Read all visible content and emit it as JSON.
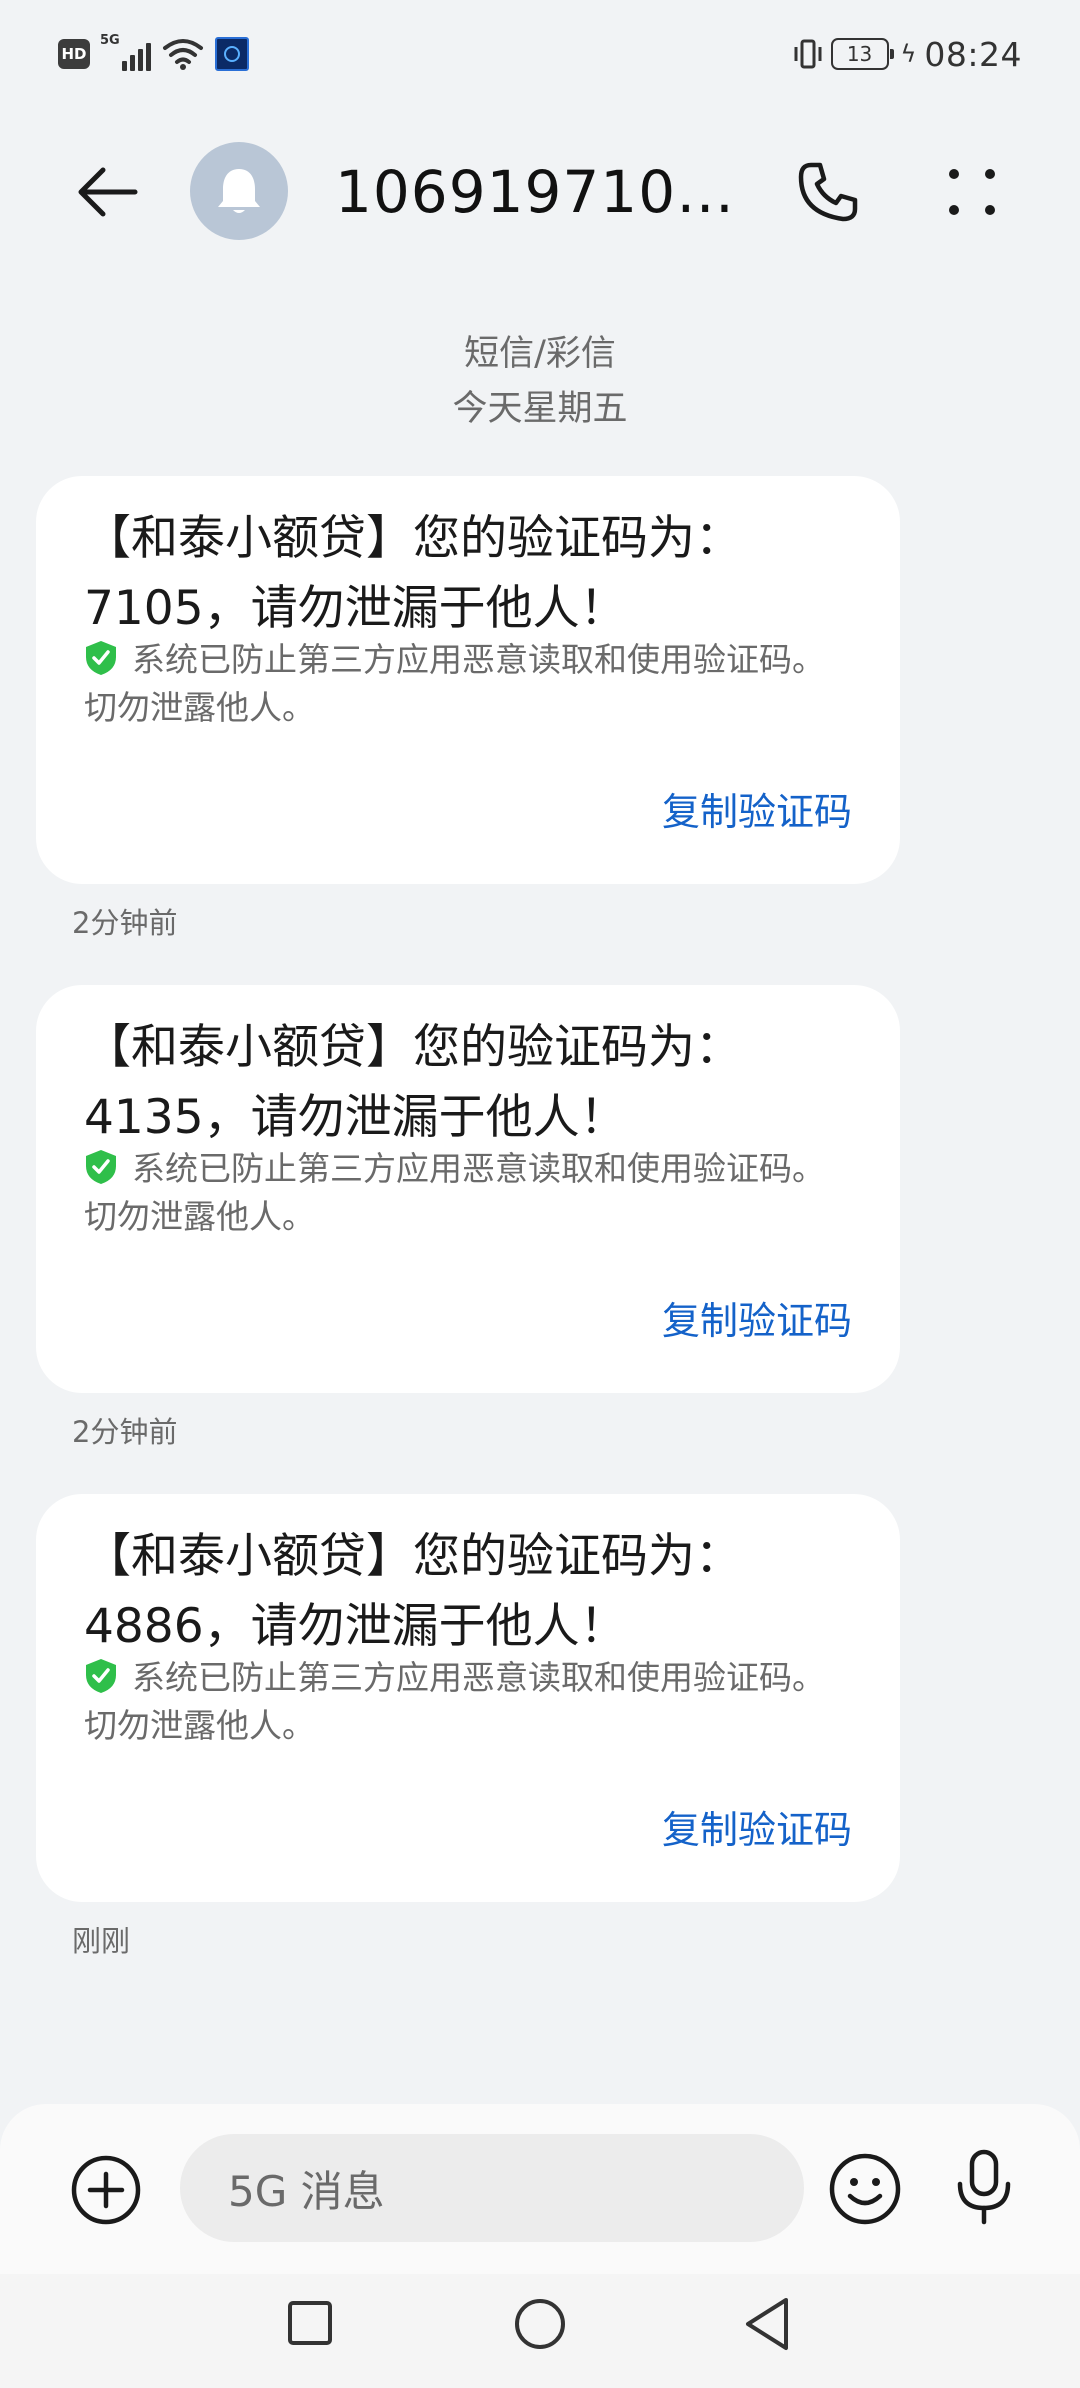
{
  "status_bar": {
    "hd_badge": "HD",
    "network": "5G",
    "battery_level": "13",
    "time": "08:24"
  },
  "header": {
    "contact_name": "1069197100..."
  },
  "conversation": {
    "message_type": "短信/彩信",
    "date": "今天星期五"
  },
  "messages": [
    {
      "line1": "【和泰小额贷】您的验证码为：",
      "line2": "7105，请勿泄漏于他人！",
      "security_note": "系统已防止第三方应用恶意读取和使用验证码。",
      "security_note2": "切勿泄露他人。",
      "copy_label": "复制验证码",
      "timestamp": "2分钟前"
    },
    {
      "line1": "【和泰小额贷】您的验证码为：",
      "line2": "4135，请勿泄漏于他人！",
      "security_note": "系统已防止第三方应用恶意读取和使用验证码。",
      "security_note2": "切勿泄露他人。",
      "copy_label": "复制验证码",
      "timestamp": "2分钟前"
    },
    {
      "line1": "【和泰小额贷】您的验证码为：",
      "line2": "4886，请勿泄漏于他人！",
      "security_note": "系统已防止第三方应用恶意读取和使用验证码。",
      "security_note2": "切勿泄露他人。",
      "copy_label": "复制验证码",
      "timestamp": "刚刚"
    }
  ],
  "composer": {
    "placeholder": "5G 消息"
  },
  "colors": {
    "background": "#f1f3f5",
    "bubble": "#ffffff",
    "link": "#1462c9",
    "shield": "#2fbf4a",
    "avatar": "#b9c6d6"
  },
  "icons": [
    "back-arrow-icon",
    "bell-icon",
    "phone-icon",
    "more-vertical-icon",
    "shield-check-icon",
    "add-circle-icon",
    "emoji-icon",
    "microphone-icon",
    "nav-recent-icon",
    "nav-home-icon",
    "nav-back-icon"
  ]
}
